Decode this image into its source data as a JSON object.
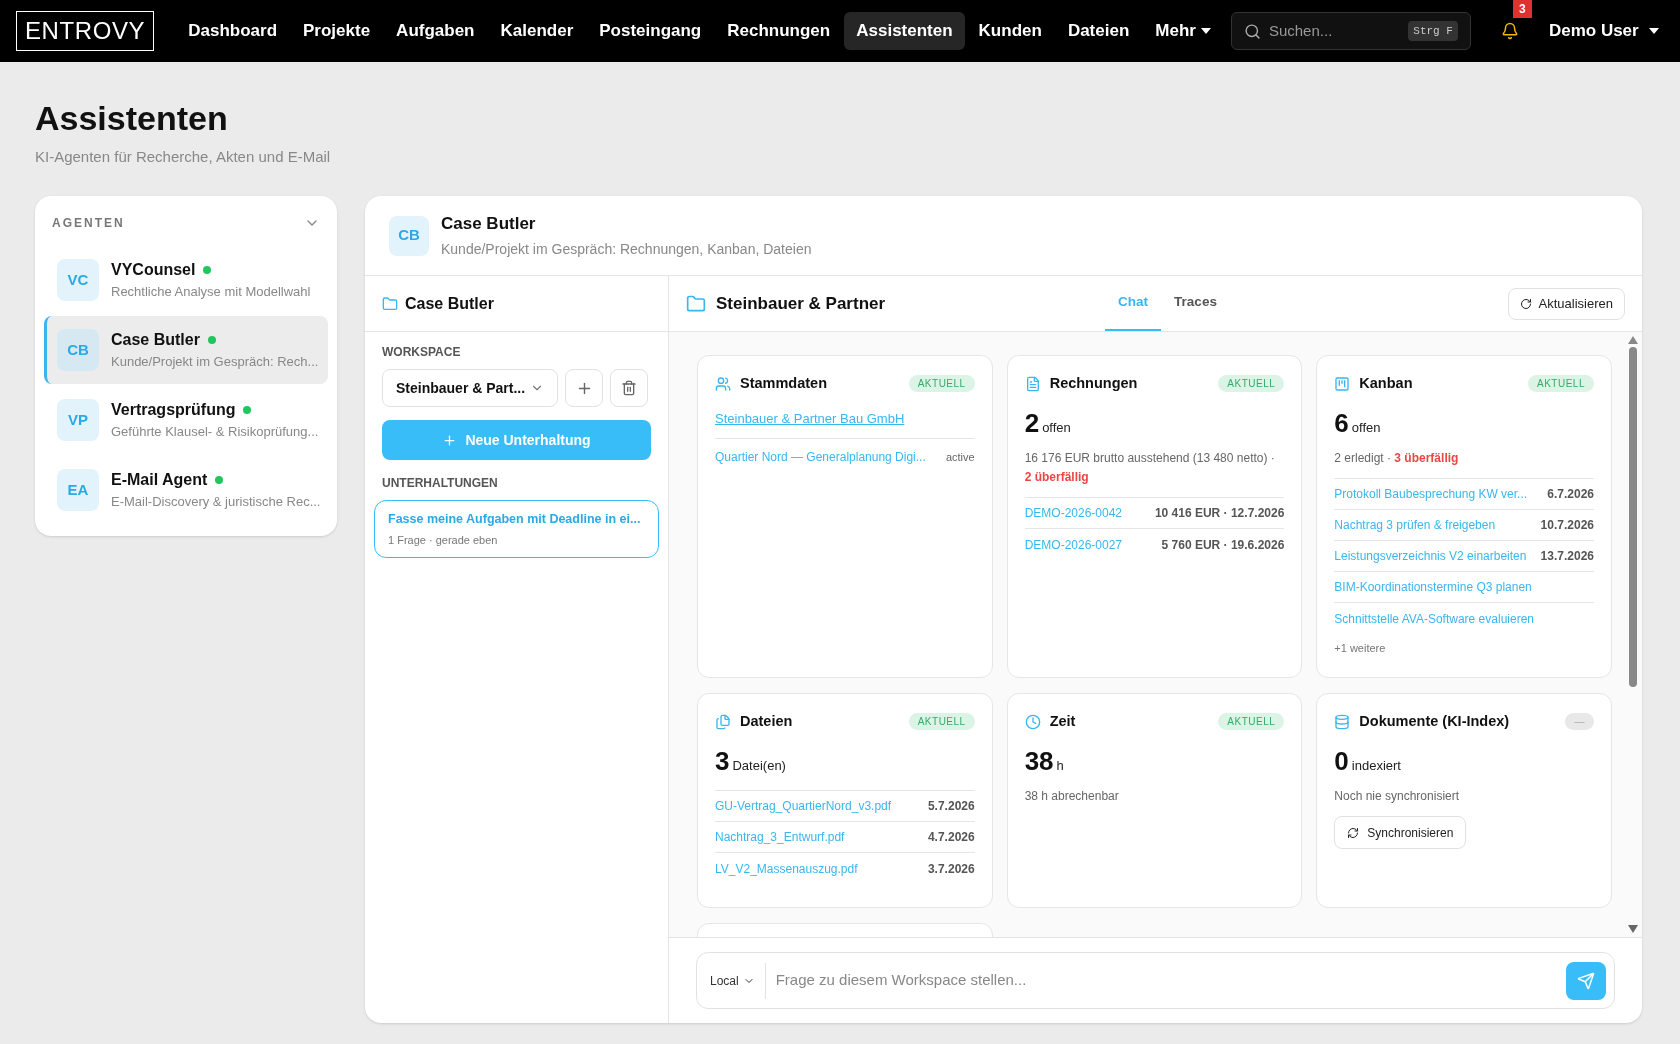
{
  "nav": {
    "logo": "ENTROVY",
    "items": [
      {
        "label": "Dashboard",
        "selected": false
      },
      {
        "label": "Projekte",
        "selected": false
      },
      {
        "label": "Aufgaben",
        "selected": false
      },
      {
        "label": "Kalender",
        "selected": false
      },
      {
        "label": "Posteingang",
        "selected": false
      },
      {
        "label": "Rechnungen",
        "selected": false
      },
      {
        "label": "Assistenten",
        "selected": true
      },
      {
        "label": "Kunden",
        "selected": false
      },
      {
        "label": "Dateien",
        "selected": false
      }
    ],
    "more": "Mehr",
    "search": {
      "placeholder": "Suchen...",
      "shortcut": "Strg F"
    },
    "notifications": "3",
    "user": "Demo User"
  },
  "page": {
    "title": "Assistenten",
    "subtitle": "KI-Agenten für Recherche, Akten und E-Mail"
  },
  "agents": {
    "heading": "AGENTEN",
    "items": [
      {
        "initials": "VC",
        "name": "VYCounsel",
        "online": true,
        "description": "Rechtliche Analyse mit Modellwahl",
        "selected": false
      },
      {
        "initials": "CB",
        "name": "Case Butler",
        "online": true,
        "description": "Kunde/Projekt im Gespräch: Rech...",
        "selected": true
      },
      {
        "initials": "VP",
        "name": "Vertragsprüfung",
        "online": true,
        "description": "Geführte Klausel- & Risikoprüfung...",
        "selected": false
      },
      {
        "initials": "EA",
        "name": "E-Mail Agent",
        "online": true,
        "description": "E-Mail-Discovery & juristische Rec...",
        "selected": false
      }
    ]
  },
  "agent_header": {
    "initials": "CB",
    "name": "Case Butler",
    "description": "Kunde/Projekt im Gespräch: Rechnungen, Kanban, Dateien"
  },
  "workspace_panel": {
    "title": "Case Butler",
    "workspace_label": "WORKSPACE",
    "workspace_value": "Steinbauer & Part...",
    "new_button": "Neue Unterhaltung",
    "conversations_label": "UNTERHALTUNGEN",
    "conversations": [
      {
        "title": "Fasse meine Aufgaben mit Deadline in ei...",
        "meta": "1 Frage · gerade eben",
        "selected": true
      }
    ]
  },
  "toolbar": {
    "title": "Steinbauer & Partner",
    "tabs": [
      {
        "label": "Chat",
        "selected": true
      },
      {
        "label": "Traces",
        "selected": false
      }
    ],
    "refresh": "Aktualisieren"
  },
  "cards": [
    {
      "kind": "stammdaten",
      "title": "Stammdaten",
      "badge": {
        "text": "AKTUELL",
        "fresh": true
      },
      "link": "Steinbauer & Partner Bau GmbH",
      "project": {
        "label": "Quartier Nord — Generalplanung Digi...",
        "status": "active"
      }
    },
    {
      "kind": "rechnungen",
      "title": "Rechnungen",
      "badge": {
        "text": "AKTUELL",
        "fresh": true
      },
      "count": {
        "value": "2",
        "unit": "offen"
      },
      "summary": {
        "text": "16 176 EUR brutto ausstehend (13 480 netto) · ",
        "alert": "2 überfällig"
      },
      "rows": [
        {
          "label": "DEMO-2026-0042",
          "value": "10 416 EUR · 12.7.2026"
        },
        {
          "label": "DEMO-2026-0027",
          "value": "5 760 EUR · 19.6.2026"
        }
      ]
    },
    {
      "kind": "kanban",
      "title": "Kanban",
      "badge": {
        "text": "AKTUELL",
        "fresh": true
      },
      "count": {
        "value": "6",
        "unit": "offen"
      },
      "summary": {
        "text": "2 erledigt · ",
        "alert": "3 überfällig"
      },
      "rows": [
        {
          "label": "Protokoll Baubesprechung KW ver...",
          "value": "6.7.2026"
        },
        {
          "label": "Nachtrag 3 prüfen & freigeben",
          "value": "10.7.2026"
        },
        {
          "label": "Leistungsverzeichnis V2 einarbeiten",
          "value": "13.7.2026"
        },
        {
          "label": "BIM-Koordinationstermine Q3 planen"
        },
        {
          "label": "Schnittstelle AVA-Software evaluieren"
        }
      ],
      "more": "+1 weitere"
    },
    {
      "kind": "dateien",
      "title": "Dateien",
      "badge": {
        "text": "AKTUELL",
        "fresh": true
      },
      "count": {
        "value": "3",
        "unit": "Datei(en)"
      },
      "rows": [
        {
          "label": "GU-Vertrag_QuartierNord_v3.pdf",
          "value": "5.7.2026"
        },
        {
          "label": "Nachtrag_3_Entwurf.pdf",
          "value": "4.7.2026"
        },
        {
          "label": "LV_V2_Massenauszug.pdf",
          "value": "3.7.2026"
        }
      ]
    },
    {
      "kind": "zeit",
      "title": "Zeit",
      "badge": {
        "text": "AKTUELL",
        "fresh": true
      },
      "count": {
        "value": "38",
        "unit": "h"
      },
      "summary": {
        "text": "38 h abrechenbar"
      }
    },
    {
      "kind": "dokumente",
      "title": "Dokumente (KI-Index)",
      "badge": {
        "text": "—",
        "fresh": false
      },
      "count": {
        "value": "0",
        "unit": "indexiert"
      },
      "summary": {
        "text": "Noch nie synchronisiert"
      },
      "button": "Synchronisieren"
    }
  ],
  "chat": {
    "model": "Local",
    "placeholder": "Frage zu diesem Workspace stellen..."
  }
}
